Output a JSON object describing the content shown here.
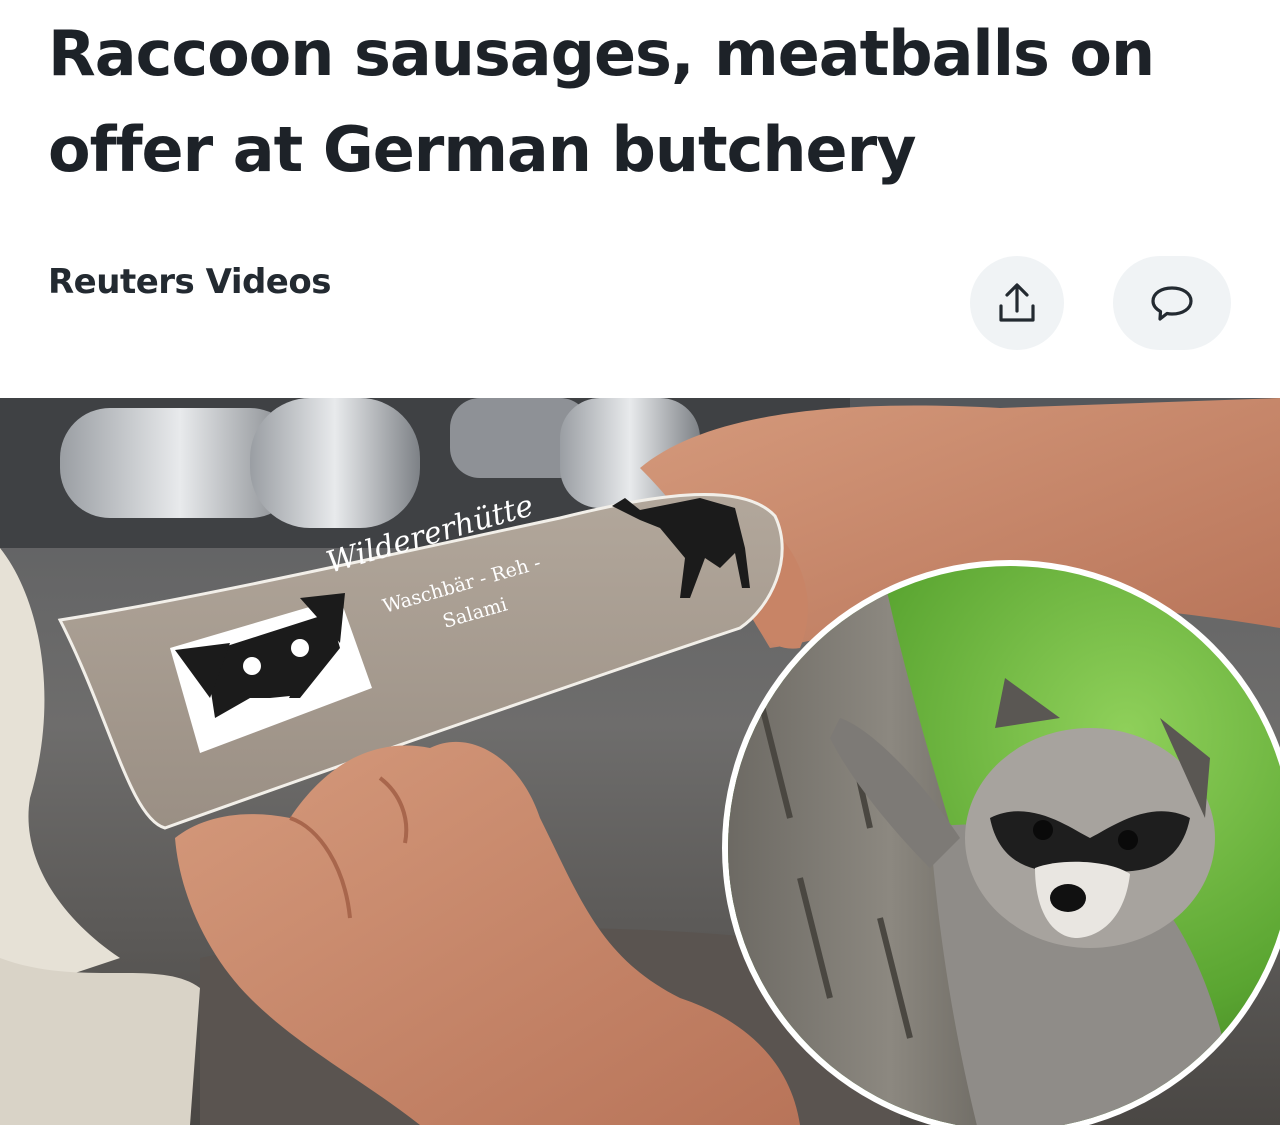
{
  "article": {
    "headline": "Raccoon sausages, meatballs on offer at German butchery",
    "source": "Reuters Videos"
  },
  "actions": {
    "share_icon": "share-icon",
    "comment_icon": "comment-icon"
  },
  "photo": {
    "package_brand": "Wildererhütte",
    "package_line1": "Waschbär - Reh -",
    "package_line2": "Salami"
  },
  "colors": {
    "headline": "#1d2228",
    "button_bg": "#f0f3f5",
    "icon": "#232a31"
  }
}
